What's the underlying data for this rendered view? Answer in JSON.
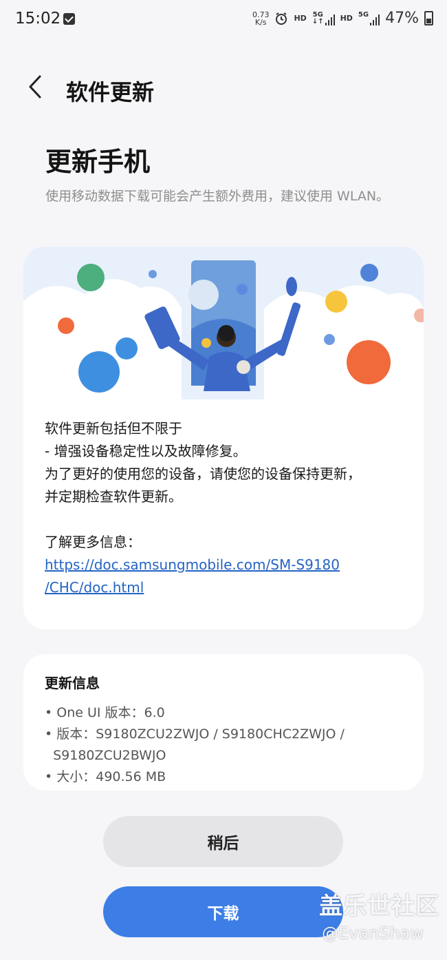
{
  "status_bar": {
    "time": "15:02",
    "net_speed_value": "0.73",
    "net_speed_unit": "K/s",
    "hd_label": "HD",
    "network_5g": "5G",
    "battery_percent": "47%"
  },
  "header": {
    "title": "软件更新"
  },
  "main": {
    "heading": "更新手机",
    "note": "使用移动数据下载可能会产生额外费用，建议使用 WLAN。",
    "card": {
      "line1": "软件更新包括但不限于",
      "line2": "- 增强设备稳定性以及故障修复。",
      "line3": "为了更好的使用您的设备，请使您的设备保持更新，",
      "line4": "并定期检查软件更新。",
      "more_label": "了解更多信息：",
      "link_line1": "https://doc.samsungmobile.com/SM-S9180",
      "link_line2": "/CHC/doc.html"
    }
  },
  "update_info": {
    "title": "更新信息",
    "one_ui": "• One UI 版本：6.0",
    "version_line1": "• 版本：S9180ZCU2ZWJO / S9180CHC2ZWJO /",
    "version_line2": "  S9180ZCU2BWJO",
    "size": "• 大小：490.56 MB"
  },
  "buttons": {
    "later": "稍后",
    "download": "下载"
  },
  "watermark": {
    "line1": "盖乐世社区",
    "line2": "@EvanShaw"
  },
  "colors": {
    "accent": "#3d7ee6",
    "link": "#2463c4",
    "background": "#f6f6f8"
  }
}
